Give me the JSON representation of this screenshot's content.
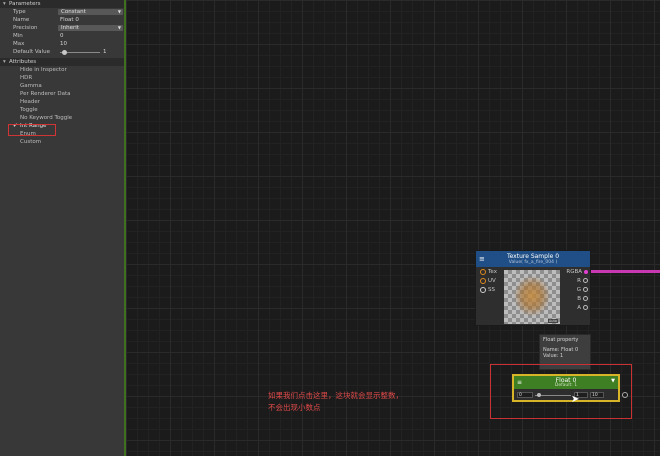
{
  "inspector": {
    "parameters_title": "Parameters",
    "properties": [
      {
        "label": "Type",
        "value": "Constant",
        "kind": "dropdown"
      },
      {
        "label": "Name",
        "value": "Float 0",
        "kind": "text"
      },
      {
        "label": "Precision",
        "value": "Inherit",
        "kind": "dropdown"
      },
      {
        "label": "Min",
        "value": "0",
        "kind": "text"
      },
      {
        "label": "Max",
        "value": "10",
        "kind": "text"
      },
      {
        "label": "Default Value",
        "value": "1",
        "kind": "slider"
      }
    ],
    "default_slider_fraction": 0.1,
    "attributes_title": "Attributes",
    "attributes": [
      {
        "label": "Hide in Inspector",
        "checked": false
      },
      {
        "label": "HDR",
        "checked": false
      },
      {
        "label": "Gamma",
        "checked": false
      },
      {
        "label": "Per Renderer Data",
        "checked": false
      },
      {
        "label": "Header",
        "checked": false
      },
      {
        "label": "Toggle",
        "checked": false
      },
      {
        "label": "No Keyword Toggle",
        "checked": false
      },
      {
        "label": "Int Range",
        "checked": true
      },
      {
        "label": "Enum",
        "checked": false
      },
      {
        "label": "Custom",
        "checked": false
      }
    ]
  },
  "texture_node": {
    "title": "Texture Sample 0",
    "subtitle": "Value( fx_a_fire_004 )",
    "inputs": [
      "Tex",
      "UV",
      "SS"
    ],
    "outputs": [
      "RGBA",
      "R",
      "G",
      "B",
      "A"
    ],
    "preview_badge": "Auto"
  },
  "tooltip": {
    "line1": "Float property",
    "line2": "Name: Float 0",
    "line3": "Value: 1"
  },
  "float_node": {
    "title": "Float 0",
    "subtitle": "Default: 1",
    "min_field": "0",
    "value_field": "1",
    "max_field": "10",
    "slider_fraction": 0.1
  },
  "annotation": {
    "line1": "如果我们点击这里，这块就会显示整数，",
    "line2": "不会出现小数点"
  },
  "colors": {
    "texture_header": "#1f4f86",
    "float_header": "#3f7f23",
    "float_border": "#d8b528",
    "annotation": "#e04848",
    "wire": "#c838b0"
  }
}
